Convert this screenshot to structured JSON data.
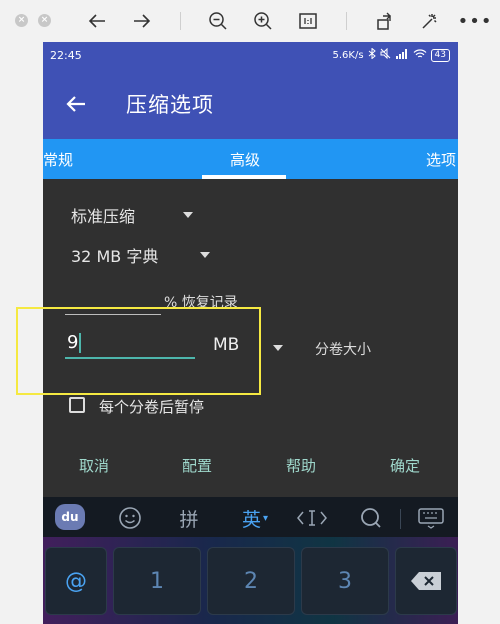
{
  "status_bar": {
    "time": "22:45",
    "network_speed": "5.6K/s",
    "battery": "43"
  },
  "app_bar": {
    "title": "压缩选项"
  },
  "tabs": [
    {
      "label": "常规"
    },
    {
      "label": "高级",
      "active": true
    },
    {
      "label": "选项"
    }
  ],
  "form": {
    "compression_level": "标准压缩",
    "dictionary": "32 MB 字典",
    "recovery_label": "% 恢复记录",
    "volume_size_value": "9",
    "volume_unit": "MB",
    "volume_size_label": "分卷大小",
    "pause_checkbox_label": "每个分卷后暂停",
    "pause_checked": false
  },
  "actions": {
    "cancel": "取消",
    "profile": "配置",
    "help": "帮助",
    "ok": "确定"
  },
  "keyboard": {
    "logo": "du",
    "pinyin": "拼",
    "english": "英",
    "keys": [
      "@",
      "1",
      "2",
      "3"
    ]
  },
  "colors": {
    "app_bar": "#3f51b5",
    "tab_bar": "#2196f3",
    "accent": "#4db6ac",
    "highlight_box": "#f5e942"
  }
}
